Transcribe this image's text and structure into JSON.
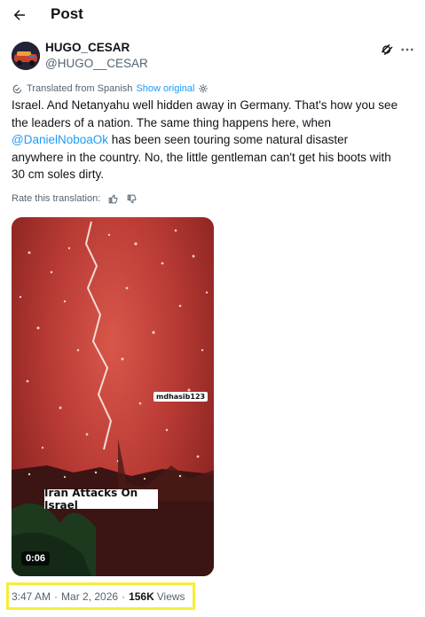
{
  "header": {
    "title": "Post",
    "back_icon": "arrow-left-icon"
  },
  "author": {
    "display_name": "HUGO_CESAR",
    "handle": "@HUGO__CESAR"
  },
  "translation": {
    "label": "Translated from Spanish",
    "show_original": "Show original"
  },
  "post": {
    "line1": "Israel. And Netanyahu well hidden away in Germany. That's how you see",
    "line2": "the leaders of a nation. The same thing happens here, when",
    "mention": "@DanielNoboaOk",
    "line3_rest": " has been seen touring some natural disaster",
    "line4": "anywhere in the country. No, the little gentleman can't get his boots with",
    "line5": "30 cm soles dirty."
  },
  "rate": {
    "label": "Rate this translation:"
  },
  "media": {
    "watermark": "mdhasib123",
    "caption": "Iran Attacks On Israel",
    "duration": "0:06"
  },
  "meta": {
    "time": "3:47 AM",
    "separator": "·",
    "date": "Mar 2, 2026",
    "views_count": "156K",
    "views_label": "Views"
  },
  "colors": {
    "link": "#1d9bf0",
    "highlight": "#f5ee3b",
    "muted": "#536471"
  }
}
